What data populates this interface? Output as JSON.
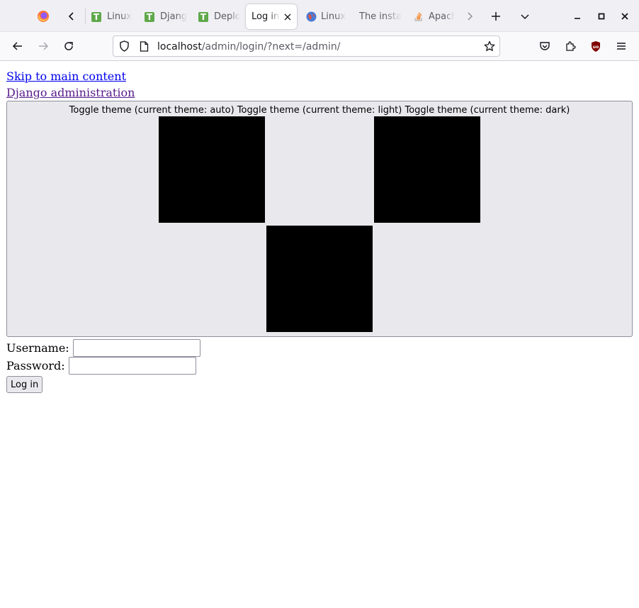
{
  "browser": {
    "tabs": [
      {
        "label": "Linux",
        "icon": "t-favicon"
      },
      {
        "label": "Djang",
        "icon": "t-favicon"
      },
      {
        "label": "Deplo",
        "icon": "t-favicon"
      },
      {
        "label": "Log in",
        "icon": "none",
        "active": true
      },
      {
        "label": "Linux",
        "icon": "globe-favicon"
      },
      {
        "label": "The insta",
        "icon": "none"
      },
      {
        "label": "Apach",
        "icon": "stackoverflow-favicon"
      }
    ],
    "url_host": "localhost",
    "url_path": "/admin/login/?next=/admin/",
    "colors": {
      "tab_bar": "#f0f0f4",
      "toolbar": "#f9f9fb",
      "ublock": "#800000",
      "t_favicon": "#5fa84a"
    }
  },
  "page": {
    "skip_link": "Skip to main content",
    "site_link": "Django administration",
    "theme_toggle_text": "Toggle theme (current theme: auto) Toggle theme (current theme: light) Toggle theme (current theme: dark)",
    "username_label": "Username:",
    "password_label": "Password:",
    "login_button": "Log in",
    "colors": {
      "link": "#0000ee",
      "visited_link": "#551a8b",
      "theme_box": "#e9e9ed"
    }
  }
}
